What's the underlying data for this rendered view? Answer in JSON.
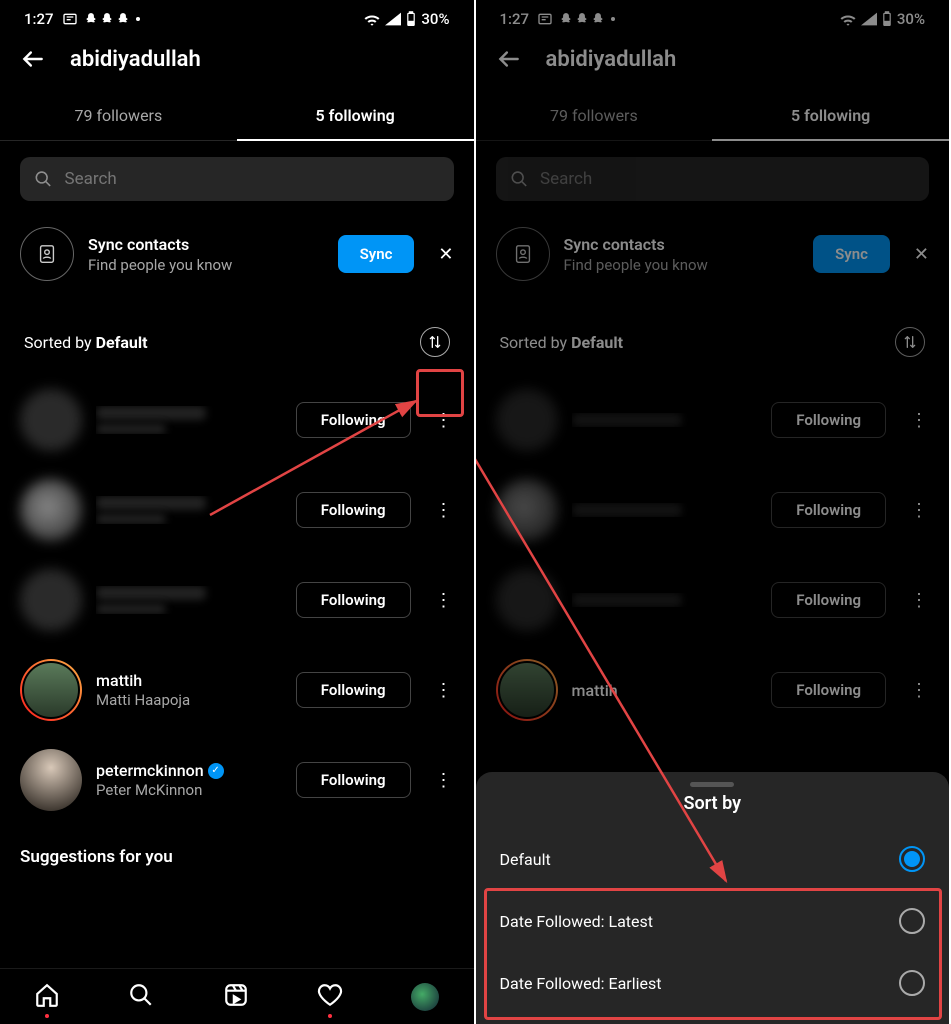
{
  "status": {
    "time": "1:27",
    "battery": "30%"
  },
  "header": {
    "username": "abidiyadullah"
  },
  "tabs": {
    "followers": "79 followers",
    "following": "5 following"
  },
  "search": {
    "placeholder": "Search"
  },
  "sync": {
    "title": "Sync contacts",
    "subtitle": "Find people you know",
    "button": "Sync"
  },
  "sorted": {
    "prefix": "Sorted by ",
    "value": "Default"
  },
  "following_label": "Following",
  "users": [
    {
      "handle": "",
      "name": ""
    },
    {
      "handle": "",
      "name": ""
    },
    {
      "handle": "",
      "name": ""
    },
    {
      "handle": "mattih",
      "name": "Matti Haapoja"
    },
    {
      "handle": "petermckinnon",
      "name": "Peter McKinnon"
    }
  ],
  "suggestions": "Suggestions for you",
  "sheet": {
    "title": "Sort by",
    "options": [
      {
        "label": "Default",
        "selected": true
      },
      {
        "label": "Date Followed: Latest",
        "selected": false
      },
      {
        "label": "Date Followed: Earliest",
        "selected": false
      }
    ]
  }
}
